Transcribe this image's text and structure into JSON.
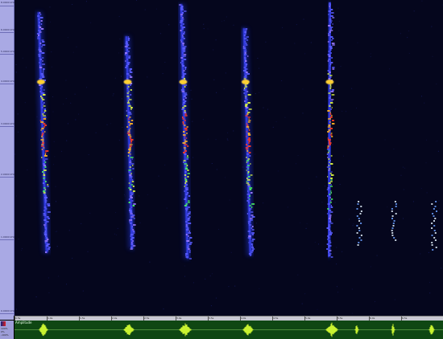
{
  "frequency_axis": {
    "labels": [
      "8.0000 kHz",
      "6.0000 kHz",
      "5.0000 kHz",
      "4.0000 kHz",
      "3.0000 kHz",
      "2.0000 kHz",
      "1.0000 kHz",
      "0.0000 kHz"
    ]
  },
  "time_ruler": {
    "labels": [
      "0.5s",
      "1.0s",
      "1.5s",
      "2.0s",
      "2.5s",
      "3.0s",
      "3.5s",
      "4.0s",
      "4.5s",
      "5.0s",
      "5.5s",
      "6.0s",
      "6.5s"
    ]
  },
  "waveform_panel": {
    "title": "Amplitude",
    "scale_labels": [
      "100%",
      "0%",
      "-100%"
    ]
  },
  "colors": {
    "spectrogram_bg": "#05061d",
    "axis_bg": "#a9a9e4",
    "waveform_bg": "#0f4713",
    "waveform_trace": "#c8f230"
  }
}
